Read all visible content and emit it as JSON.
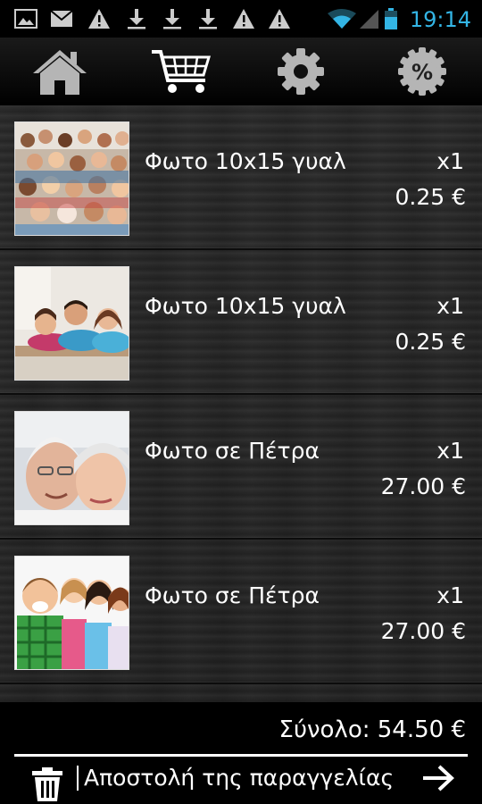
{
  "status_bar": {
    "time": "19:14",
    "icons": [
      "image-icon",
      "mail-icon",
      "warning-icon",
      "download-icon",
      "download-icon",
      "download-icon",
      "warning-icon",
      "warning-icon",
      "wifi-icon",
      "signal-icon",
      "battery-icon"
    ]
  },
  "nav": {
    "icons": [
      "home-icon",
      "cart-icon",
      "settings-icon",
      "discount-icon"
    ],
    "discount_symbol": "%"
  },
  "cart": {
    "items": [
      {
        "title": "Φωτο 10x15 γυαλ",
        "qty": "x1",
        "price": "0.25 €",
        "thumb": "group-photo"
      },
      {
        "title": "Φωτο 10x15 γυαλ",
        "qty": "x1",
        "price": "0.25 €",
        "thumb": "family-photo"
      },
      {
        "title": "Φωτο σε Πέτρα",
        "qty": "x1",
        "price": "27.00 €",
        "thumb": "elderly-couple-photo"
      },
      {
        "title": "Φωτο σε Πέτρα",
        "qty": "x1",
        "price": "27.00 €",
        "thumb": "children-photo"
      }
    ]
  },
  "footer": {
    "total": "Σύνολο: 54.50 €",
    "send_label": "Αποστολή της παραγγελίας"
  }
}
